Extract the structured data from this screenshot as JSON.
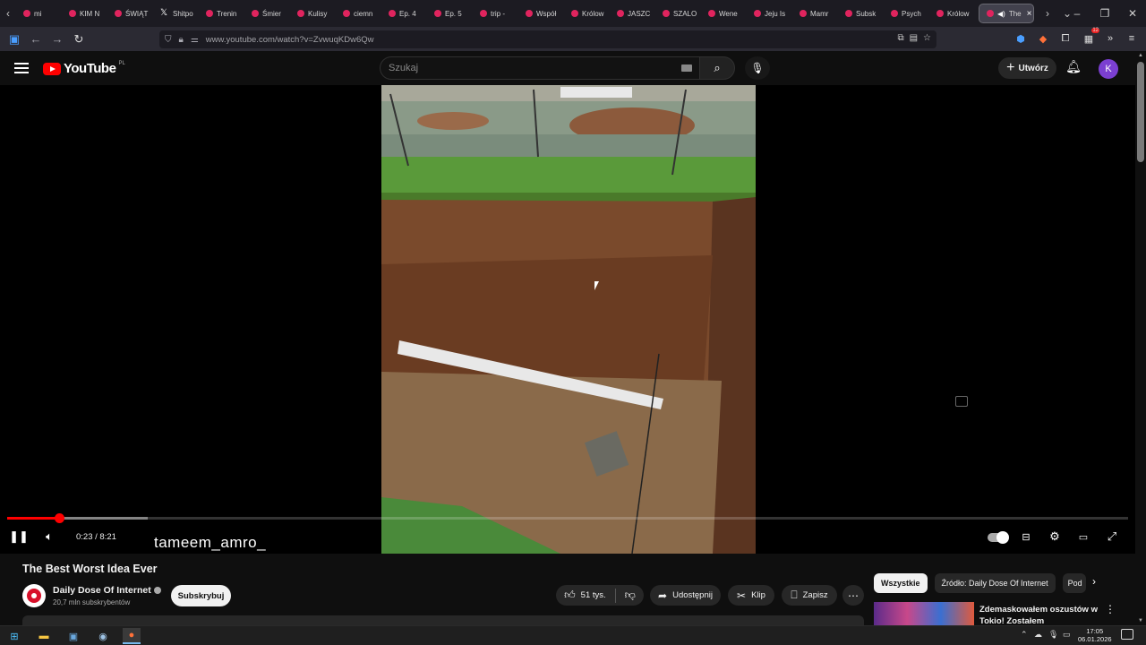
{
  "browser": {
    "tabs": [
      {
        "label": "mi",
        "icon": "youtube"
      },
      {
        "label": "KIM N",
        "icon": "youtube"
      },
      {
        "label": "ŚWIĄT",
        "icon": "youtube"
      },
      {
        "label": "Shitpo",
        "icon": "x"
      },
      {
        "label": "Trenin",
        "icon": "youtube"
      },
      {
        "label": "Śmier",
        "icon": "youtube"
      },
      {
        "label": "Kulisy",
        "icon": "youtube"
      },
      {
        "label": "ciemn",
        "icon": "youtube"
      },
      {
        "label": "Ep. 4",
        "icon": "youtube"
      },
      {
        "label": "Ep. 5",
        "icon": "youtube"
      },
      {
        "label": "trip -",
        "icon": "youtube"
      },
      {
        "label": "Współ",
        "icon": "youtube"
      },
      {
        "label": "Królow",
        "icon": "youtube"
      },
      {
        "label": "JASZC",
        "icon": "youtube"
      },
      {
        "label": "SZALO",
        "icon": "youtube"
      },
      {
        "label": "Wene",
        "icon": "youtube"
      },
      {
        "label": "Jeju Is",
        "icon": "youtube"
      },
      {
        "label": "Mamr",
        "icon": "youtube"
      },
      {
        "label": "Subsk",
        "icon": "youtube"
      },
      {
        "label": "Psych",
        "icon": "youtube"
      },
      {
        "label": "Królow",
        "icon": "youtube"
      }
    ],
    "active_tab": "The",
    "url": "www.youtube.com/watch?v=ZvwuqKDw6Qw",
    "extension_badge": "12"
  },
  "masthead": {
    "logo_text": "YouTube",
    "country": "PL",
    "search_placeholder": "Szukaj",
    "create_label": "Utwórz",
    "avatar_letter": "K"
  },
  "player": {
    "watermark": "tameem_amro_",
    "current_time": "0:23",
    "duration": "8:21",
    "time_display": "0:23 / 8:21",
    "played_fraction": 0.046,
    "buffered_fraction": 0.125
  },
  "video": {
    "title": "The Best Worst Idea Ever",
    "channel_name": "Daily Dose Of Internet",
    "subscribers": "20,7 mln subskrybentów",
    "subscribe_label": "Subskrybuj",
    "likes": "51 tys.",
    "share_label": "Udostępnij",
    "clip_label": "Klip",
    "save_label": "Zapisz"
  },
  "recommendations": {
    "chips": [
      "Wszystkie",
      "Źródło: Daily Dose Of Internet",
      "Pod"
    ],
    "first_title": "Zdemaskowałem oszustów w Tokio! Zostałem zaatakowany..."
  },
  "taskbar": {
    "time": "17:05",
    "date": "06.01.2026"
  },
  "colors": {
    "brand_red": "#ff0000",
    "progress_red": "#ff0000",
    "background": "#0f0f0f",
    "avatar_purple": "#7b3fd1"
  }
}
